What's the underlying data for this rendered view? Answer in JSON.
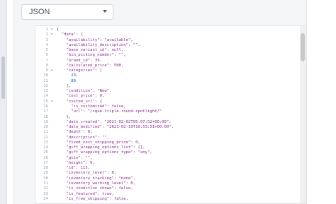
{
  "format_select": {
    "value": "JSON"
  },
  "editor": {
    "lines": [
      {
        "n": "1",
        "fold": "v",
        "t": "{",
        "kind": "p"
      },
      {
        "n": "2",
        "fold": "v",
        "t": "  \"data\": {",
        "kind": "k"
      },
      {
        "n": "3",
        "fold": "",
        "t": "    \"availability\": \"available\",",
        "kind": "k"
      },
      {
        "n": "4",
        "fold": "",
        "t": "    \"availability_description\": \"\",",
        "kind": "k"
      },
      {
        "n": "5",
        "fold": "",
        "t": "    \"base_variant_id\": null,",
        "kind": "k"
      },
      {
        "n": "6",
        "fold": "",
        "t": "    \"bin_picking_number\": \"\",",
        "kind": "k"
      },
      {
        "n": "7",
        "fold": "",
        "t": "    \"brand_id\": 39,",
        "kind": "k"
      },
      {
        "n": "8",
        "fold": "",
        "t": "    \"calculated_price\": 500,",
        "kind": "k"
      },
      {
        "n": "9",
        "fold": "v",
        "t": "    \"categories\": [",
        "kind": "k"
      },
      {
        "n": "10",
        "fold": "",
        "t": "      23,",
        "kind": "n"
      },
      {
        "n": "11",
        "fold": "",
        "t": "      80",
        "kind": "n"
      },
      {
        "n": "12",
        "fold": "",
        "t": "    ],",
        "kind": "p"
      },
      {
        "n": "13",
        "fold": "",
        "t": "    \"condition\": \"New\",",
        "kind": "k"
      },
      {
        "n": "14",
        "fold": "",
        "t": "    \"cost_price\": 0,",
        "kind": "k"
      },
      {
        "n": "15",
        "fold": "v",
        "t": "    \"custom_url\": {",
        "kind": "k"
      },
      {
        "n": "16",
        "fold": "",
        "t": "      \"is_customized\": false,",
        "kind": "k"
      },
      {
        "n": "17",
        "fold": "",
        "t": "      \"url\": \"/sque-triple-round-spotlight/\"",
        "kind": "k"
      },
      {
        "n": "18",
        "fold": "",
        "t": "    },",
        "kind": "p"
      },
      {
        "n": "19",
        "fold": "",
        "t": "    \"date_created\": \"2021-02-02T05:07:52+00:00\",",
        "kind": "k"
      },
      {
        "n": "20",
        "fold": "",
        "t": "    \"date_modified\": \"2021-02-19T10:53:51+00:00\",",
        "kind": "k"
      },
      {
        "n": "21",
        "fold": "",
        "t": "    \"depth\": 0,",
        "kind": "k"
      },
      {
        "n": "22",
        "fold": "",
        "t": "    \"description\": \"\",",
        "kind": "k"
      },
      {
        "n": "23",
        "fold": "",
        "t": "    \"fixed_cost_shipping_price\": 0,",
        "kind": "k"
      },
      {
        "n": "24",
        "fold": "",
        "t": "    \"gift_wrapping_options_list\": [],",
        "kind": "k"
      },
      {
        "n": "25",
        "fold": "",
        "t": "    \"gift_wrapping_options_type\": \"any\",",
        "kind": "k"
      },
      {
        "n": "26",
        "fold": "",
        "t": "    \"gtin\": \"\",",
        "kind": "k"
      },
      {
        "n": "27",
        "fold": "",
        "t": "    \"height\": 0,",
        "kind": "k"
      },
      {
        "n": "28",
        "fold": "",
        "t": "    \"id\": 115,",
        "kind": "k"
      },
      {
        "n": "29",
        "fold": "",
        "t": "    \"inventory_level\": 0,",
        "kind": "k"
      },
      {
        "n": "30",
        "fold": "",
        "t": "    \"inventory_tracking\": \"none\",",
        "kind": "k"
      },
      {
        "n": "31",
        "fold": "",
        "t": "    \"inventory_warning_level\": 0,",
        "kind": "k"
      },
      {
        "n": "32",
        "fold": "",
        "t": "    \"is_condition_shown\": false,",
        "kind": "k"
      },
      {
        "n": "33",
        "fold": "",
        "t": "    \"is_featured\": true,",
        "kind": "k"
      },
      {
        "n": "34",
        "fold": "",
        "t": "    \"is_free_shipping\": false,",
        "kind": "k"
      }
    ]
  }
}
